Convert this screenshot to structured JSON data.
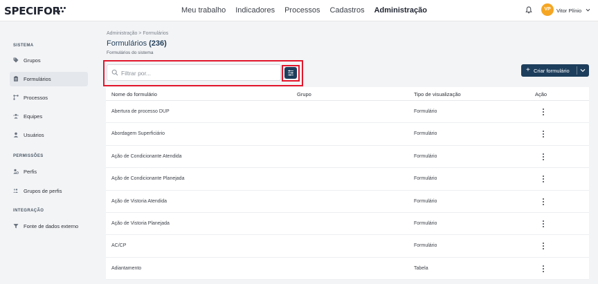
{
  "app": {
    "logo_text": "SPECIFOR"
  },
  "topnav": {
    "items": [
      {
        "label": "Meu trabalho"
      },
      {
        "label": "Indicadores"
      },
      {
        "label": "Processos"
      },
      {
        "label": "Cadastros"
      },
      {
        "label": "Administração",
        "active": true
      }
    ]
  },
  "user": {
    "initials": "VP",
    "name": "Vitor Plínio",
    "avatar_color": "#f5a623"
  },
  "sidebar": {
    "sections": [
      {
        "title": "SISTEMA"
      },
      {
        "title": "PERMISSÕES"
      },
      {
        "title": "INTEGRAÇÃO"
      }
    ],
    "items": [
      {
        "label": "Grupos",
        "icon": "tag-icon"
      },
      {
        "label": "Formulários",
        "icon": "clipboard-icon",
        "active": true
      },
      {
        "label": "Processos",
        "icon": "process-icon"
      },
      {
        "label": "Equipes",
        "icon": "team-icon"
      },
      {
        "label": "Usuários",
        "icon": "user-icon"
      },
      {
        "label": "Perfis",
        "icon": "profile-gear-icon"
      },
      {
        "label": "Grupos de perfis",
        "icon": "profile-group-icon"
      },
      {
        "label": "Fonte de dados externo",
        "icon": "funnel-icon"
      }
    ]
  },
  "main": {
    "breadcrumb": "Administração  >  Formulários",
    "title": "Formulários",
    "count": "(236)",
    "subtitle": "Formulários do sistema",
    "search": {
      "placeholder": "Filtrar por...",
      "value": ""
    },
    "create_button": {
      "label": "Criar formulário"
    },
    "accent_color": "#1d3e5c",
    "highlight_color": "#e3162b"
  },
  "table": {
    "columns": [
      "Nome do formulário",
      "Grupo",
      "Tipo de visualização",
      "Ação"
    ],
    "rows": [
      {
        "name": "Abertura de processo DUP",
        "group": "",
        "type": "Formulário"
      },
      {
        "name": "Abordagem Superficiário",
        "group": "",
        "type": "Formulário"
      },
      {
        "name": "Ação de Condicionante Atendida",
        "group": "",
        "type": "Formulário"
      },
      {
        "name": "Ação de Condicionante Planejada",
        "group": "",
        "type": "Formulário"
      },
      {
        "name": "Ação de Vistoria Atendida",
        "group": "",
        "type": "Formulário"
      },
      {
        "name": "Ação de Vistoria Planejada",
        "group": "",
        "type": "Formulário"
      },
      {
        "name": "AC/CP",
        "group": "",
        "type": "Formulário"
      },
      {
        "name": "Adiantamento",
        "group": "",
        "type": "Tabela"
      }
    ]
  }
}
